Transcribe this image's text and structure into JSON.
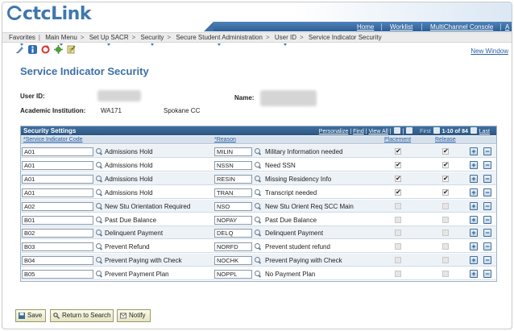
{
  "app": {
    "logo_text": "ctcLink",
    "brand_color": "#3f77ad"
  },
  "topnav": {
    "home": "Home",
    "worklist": "Worklist",
    "multichannel": "MultiChannel Console",
    "more": "A"
  },
  "breadcrumb": [
    "Favorites",
    "Main Menu",
    "Set Up SACR",
    "Security",
    "Secure Student Administration",
    "User ID",
    "Service Indicator Security"
  ],
  "toolbar": {
    "new_window": "New Window",
    "icons": [
      "edit-icon",
      "info-icon",
      "refresh-icon",
      "settings-icon",
      "notes-icon"
    ]
  },
  "page": {
    "title": "Service Indicator Security"
  },
  "fields": {
    "user_id_label": "User ID:",
    "name_label": "Name:",
    "institution_label": "Academic Institution:",
    "institution_code": "WA171",
    "institution_name": "Spokane CC"
  },
  "grid": {
    "title": "Security Settings",
    "personalize": "Personalize",
    "find": "Find",
    "view_all": "View All",
    "first": "First",
    "range": "1-10 of 84",
    "last": "Last",
    "col_code": "*Service Indicator Code",
    "col_reason": "*Reason",
    "col_placement": "Placement",
    "col_release": "Release",
    "rows": [
      {
        "code": "A01",
        "desc": "Admissions Hold",
        "reason": "MILIN",
        "reason_desc": "Military Information needed",
        "placement": "✔",
        "release": "✔"
      },
      {
        "code": "A01",
        "desc": "Admissions Hold",
        "reason": "NSSN",
        "reason_desc": "Need SSN",
        "placement": "✔",
        "release": "✔"
      },
      {
        "code": "A01",
        "desc": "Admissions Hold",
        "reason": "RESIN",
        "reason_desc": "Missing Residency Info",
        "placement": "✔",
        "release": "✔"
      },
      {
        "code": "A01",
        "desc": "Admissions Hold",
        "reason": "TRAN",
        "reason_desc": "Transcript needed",
        "placement": "✔",
        "release": "✔"
      },
      {
        "code": "A02",
        "desc": "New Stu Orientation Required",
        "reason": "NSO",
        "reason_desc": "New Stu Orient Req SCC Main",
        "placement": "",
        "release": ""
      },
      {
        "code": "B01",
        "desc": "Past Due Balance",
        "reason": "NOPAY",
        "reason_desc": "Past Due Balance",
        "placement": "",
        "release": ""
      },
      {
        "code": "B02",
        "desc": "Delinquent Payment",
        "reason": "DELQ",
        "reason_desc": "Delinquent Payment",
        "placement": "",
        "release": ""
      },
      {
        "code": "B03",
        "desc": "Prevent Refund",
        "reason": "NORFD",
        "reason_desc": "Prevent student refund",
        "placement": "",
        "release": ""
      },
      {
        "code": "B04",
        "desc": "Prevent Paying with Check",
        "reason": "NOCHK",
        "reason_desc": "Prevent Paying with Check",
        "placement": "",
        "release": ""
      },
      {
        "code": "B05",
        "desc": "Prevent Payment Plan",
        "reason": "NOPPL",
        "reason_desc": "No Payment Plan",
        "placement": "",
        "release": ""
      }
    ]
  },
  "buttons": {
    "save": "Save",
    "return": "Return to Search",
    "notify": "Notify"
  }
}
